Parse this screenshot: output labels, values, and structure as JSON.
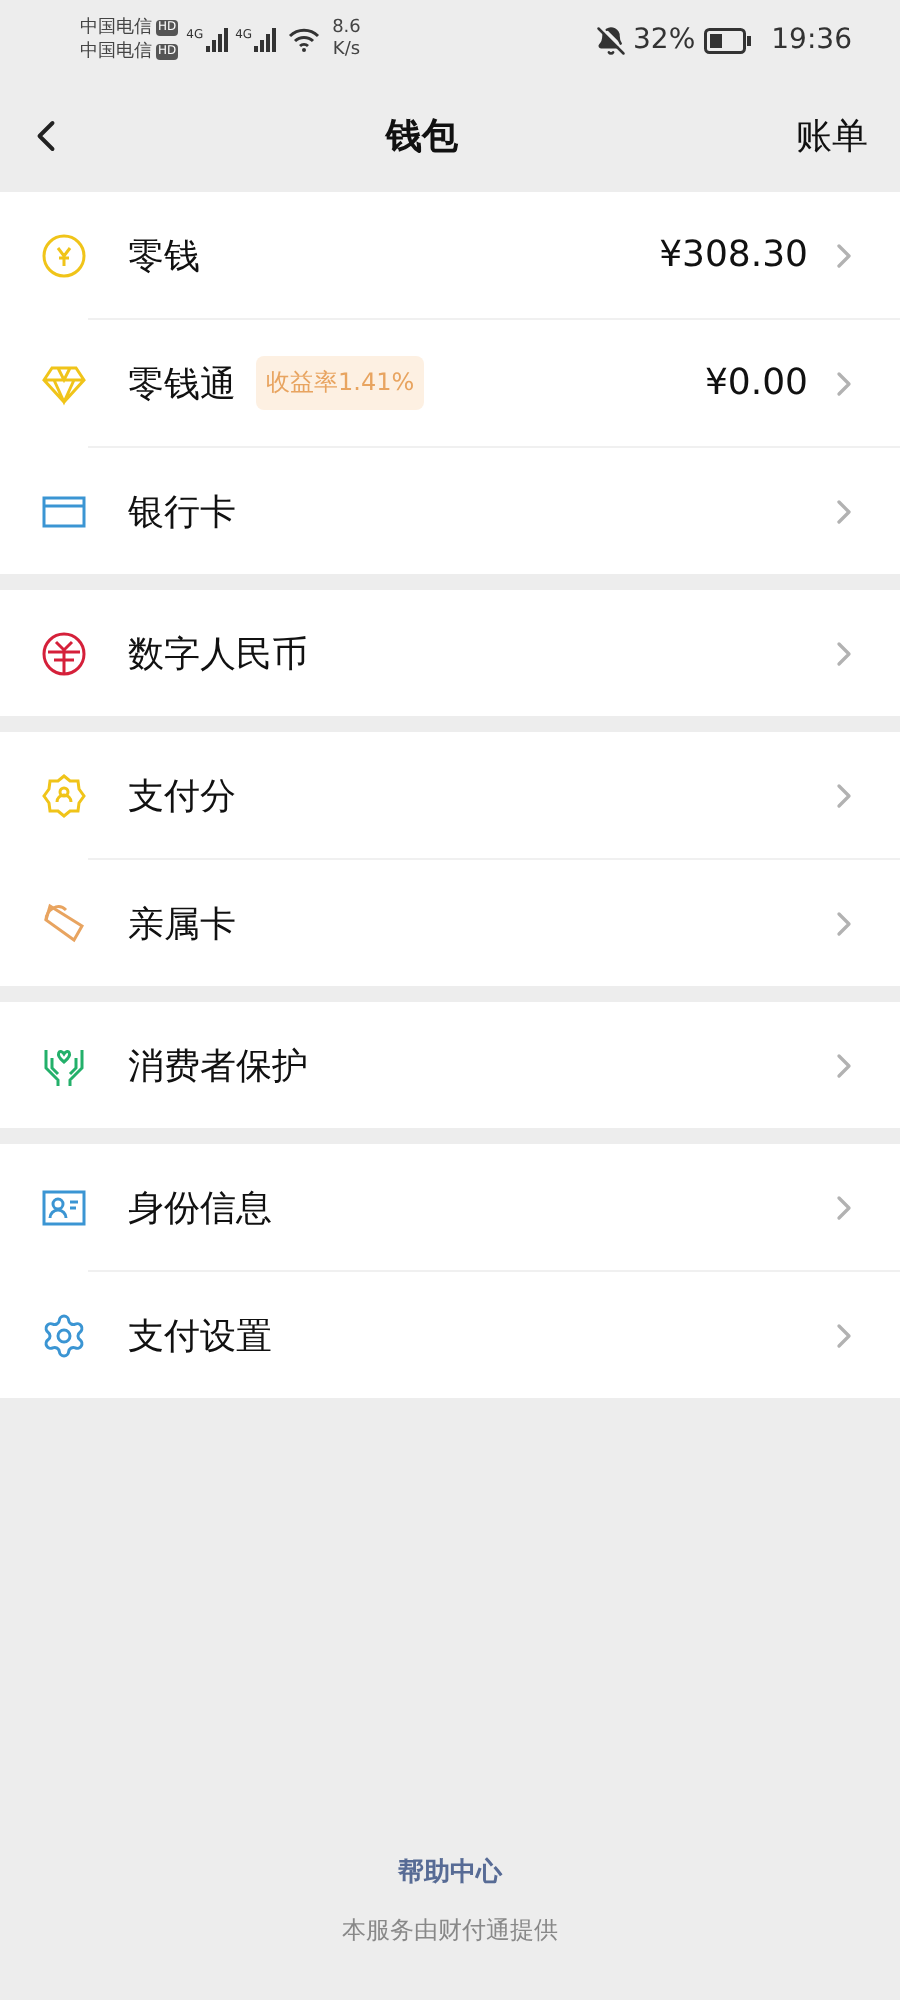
{
  "status_bar": {
    "carriers": [
      {
        "name": "中国电信",
        "badge": "HD"
      },
      {
        "name": "中国电信",
        "badge": "HD"
      }
    ],
    "networks": [
      "4G",
      "4G"
    ],
    "speed_value": "8.6",
    "speed_unit": "K/s",
    "battery": "32%",
    "time": "19:36"
  },
  "header": {
    "title": "钱包",
    "action": "账单"
  },
  "sections": [
    {
      "items": [
        {
          "kind": "coin",
          "label": "零钱",
          "value": "¥308.30"
        },
        {
          "kind": "diamond",
          "label": "零钱通",
          "tag": "收益率1.41%",
          "value": "¥0.00"
        },
        {
          "kind": "card",
          "label": "银行卡"
        }
      ]
    },
    {
      "items": [
        {
          "kind": "rmb",
          "label": "数字人民币"
        }
      ]
    },
    {
      "items": [
        {
          "kind": "score",
          "label": "支付分"
        },
        {
          "kind": "family",
          "label": "亲属卡"
        }
      ]
    },
    {
      "items": [
        {
          "kind": "hands",
          "label": "消费者保护"
        }
      ]
    },
    {
      "items": [
        {
          "kind": "id",
          "label": "身份信息"
        },
        {
          "kind": "gear",
          "label": "支付设置"
        }
      ]
    }
  ],
  "footer": {
    "link": "帮助中心",
    "note": "本服务由财付通提供"
  }
}
